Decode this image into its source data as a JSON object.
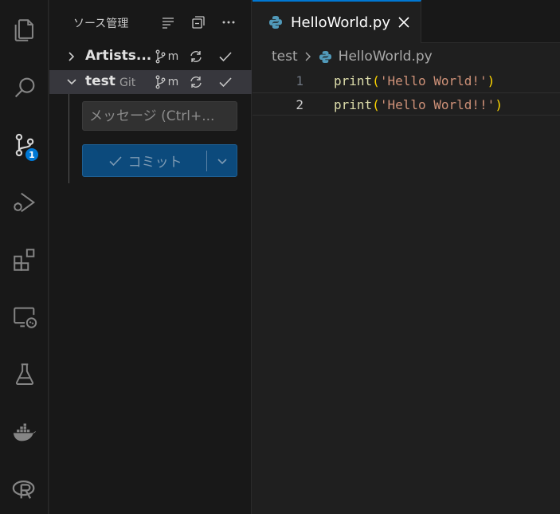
{
  "activity_bar": {
    "items": [
      "explorer-icon",
      "search-icon",
      "source-control-icon",
      "run-debug-icon",
      "extensions-icon",
      "remote-explorer-icon",
      "testing-icon",
      "docker-icon",
      "r-icon"
    ],
    "source_control_badge": "1"
  },
  "sidebar": {
    "title": "ソース管理",
    "repos": [
      {
        "name": "Artists...",
        "sub": "",
        "branch_suffix": "m"
      },
      {
        "name": "test",
        "sub": "Git",
        "branch_suffix": "m"
      }
    ],
    "message_placeholder": "メッセージ (Ctrl+...",
    "commit_label": "コミット"
  },
  "editor": {
    "tab_label": "HelloWorld.py",
    "breadcrumb": {
      "folder": "test",
      "file": "HelloWorld.py"
    },
    "lines": [
      {
        "number": "1",
        "fn": "print",
        "open": "(",
        "str": "'Hello World!'",
        "close": ")"
      },
      {
        "number": "2",
        "fn": "print",
        "open": "(",
        "str": "'Hello World!!'",
        "close": ")"
      }
    ]
  },
  "colors": {
    "accent": "#0078d4",
    "commit_button": "#0c4a7c",
    "string": "#ce9178",
    "function": "#dcdcaa",
    "bracket": "#ffd700"
  }
}
